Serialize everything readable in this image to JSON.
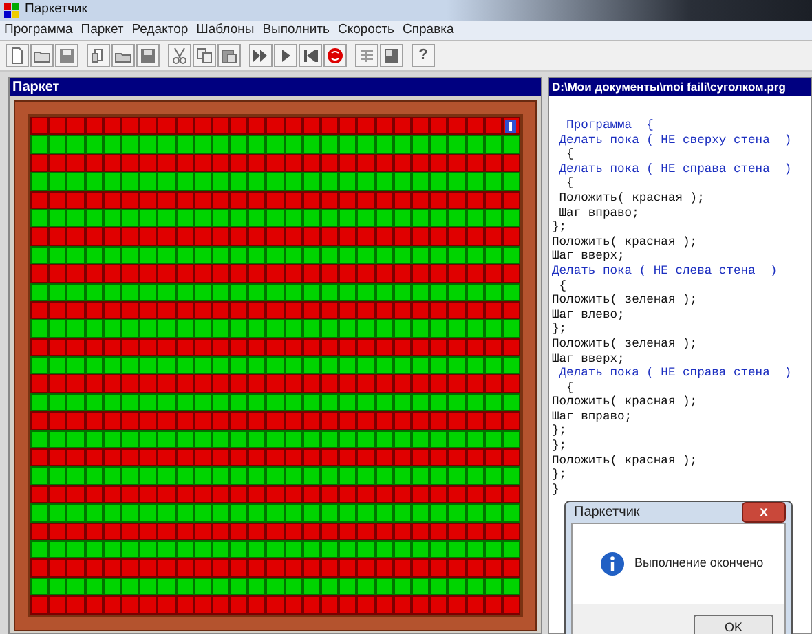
{
  "window": {
    "title": "Паркетчик"
  },
  "menu": [
    "Программа",
    "Паркет",
    "Редактор",
    "Шаблоны",
    "Выполнить",
    "Скорость",
    "Справка"
  ],
  "toolbar": {
    "help": "?"
  },
  "board": {
    "title": "Паркет",
    "rows": [
      {
        "color": "#e00000"
      },
      {
        "color": "#00d400"
      },
      {
        "color": "#e00000"
      },
      {
        "color": "#00d400"
      },
      {
        "color": "#e00000"
      },
      {
        "color": "#00d400"
      },
      {
        "color": "#e00000"
      },
      {
        "color": "#00d400"
      },
      {
        "color": "#e00000"
      },
      {
        "color": "#00d400"
      },
      {
        "color": "#e00000"
      },
      {
        "color": "#00d400"
      },
      {
        "color": "#e00000"
      },
      {
        "color": "#00d400"
      },
      {
        "color": "#e00000"
      },
      {
        "color": "#00d400"
      },
      {
        "color": "#e00000"
      },
      {
        "color": "#00d400"
      },
      {
        "color": "#e00000"
      },
      {
        "color": "#00d400"
      },
      {
        "color": "#e00000"
      },
      {
        "color": "#00d400"
      },
      {
        "color": "#e00000"
      },
      {
        "color": "#00d400"
      },
      {
        "color": "#e00000"
      },
      {
        "color": "#00d400"
      },
      {
        "color": "#e00000"
      }
    ]
  },
  "editor": {
    "title": "D:\\Мои документы\\moi faili\\суголком.prg",
    "lines": [
      {
        "text": "  Программа  {",
        "kind": "keyword"
      },
      {
        "text": " Делать пока ( НЕ сверху стена  )",
        "kind": "keyword"
      },
      {
        "text": "  {",
        "kind": "plain"
      },
      {
        "text": " Делать пока ( НЕ справа стена  )",
        "kind": "keyword"
      },
      {
        "text": "  {",
        "kind": "plain"
      },
      {
        "text": " Положить( красная );",
        "kind": "plain"
      },
      {
        "text": " Шаг вправо;",
        "kind": "plain"
      },
      {
        "text": "};",
        "kind": "plain"
      },
      {
        "text": "Положить( красная );",
        "kind": "plain"
      },
      {
        "text": "Шаг вверх;",
        "kind": "plain"
      },
      {
        "text": "Делать пока ( НЕ слева стена  )",
        "kind": "keyword"
      },
      {
        "text": " {",
        "kind": "plain"
      },
      {
        "text": "Положить( зеленая );",
        "kind": "plain"
      },
      {
        "text": "Шаг влево;",
        "kind": "plain"
      },
      {
        "text": "};",
        "kind": "plain"
      },
      {
        "text": "Положить( зеленая );",
        "kind": "plain"
      },
      {
        "text": "Шаг вверх;",
        "kind": "plain"
      },
      {
        "text": " Делать пока ( НЕ справа стена  )",
        "kind": "keyword"
      },
      {
        "text": "  {",
        "kind": "plain"
      },
      {
        "text": "Положить( красная );",
        "kind": "plain"
      },
      {
        "text": "Шаг вправо;",
        "kind": "plain"
      },
      {
        "text": "};",
        "kind": "plain"
      },
      {
        "text": "};",
        "kind": "plain"
      },
      {
        "text": "Положить( красная );",
        "kind": "plain"
      },
      {
        "text": "};",
        "kind": "plain"
      },
      {
        "text": "}",
        "kind": "plain"
      }
    ]
  },
  "dialog": {
    "title": "Паркетчик",
    "close": "x",
    "message": "Выполнение окончено",
    "button": "OK"
  }
}
